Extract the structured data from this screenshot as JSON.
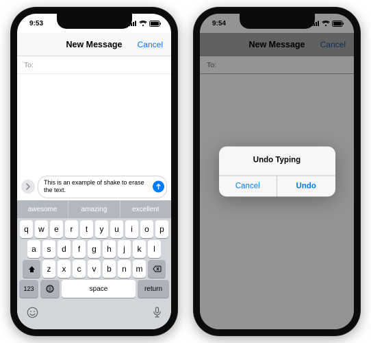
{
  "phone1": {
    "status_time": "9:53",
    "nav_title": "New Message",
    "nav_cancel": "Cancel",
    "to_label": "To:",
    "compose_text": "This is an example of shake to erase the text.",
    "predictive": [
      "awesome",
      "amazing",
      "excellent"
    ],
    "keys_row1": [
      "q",
      "w",
      "e",
      "r",
      "t",
      "y",
      "u",
      "i",
      "o",
      "p"
    ],
    "keys_row2": [
      "a",
      "s",
      "d",
      "f",
      "g",
      "h",
      "j",
      "k",
      "l"
    ],
    "keys_row3": [
      "z",
      "x",
      "c",
      "v",
      "b",
      "n",
      "m"
    ],
    "key_numeric": "123",
    "key_space": "space",
    "key_return": "return"
  },
  "phone2": {
    "status_time": "9:54",
    "nav_title": "New Message",
    "nav_cancel": "Cancel",
    "to_label": "To:",
    "alert_title": "Undo Typing",
    "alert_cancel": "Cancel",
    "alert_undo": "Undo"
  }
}
